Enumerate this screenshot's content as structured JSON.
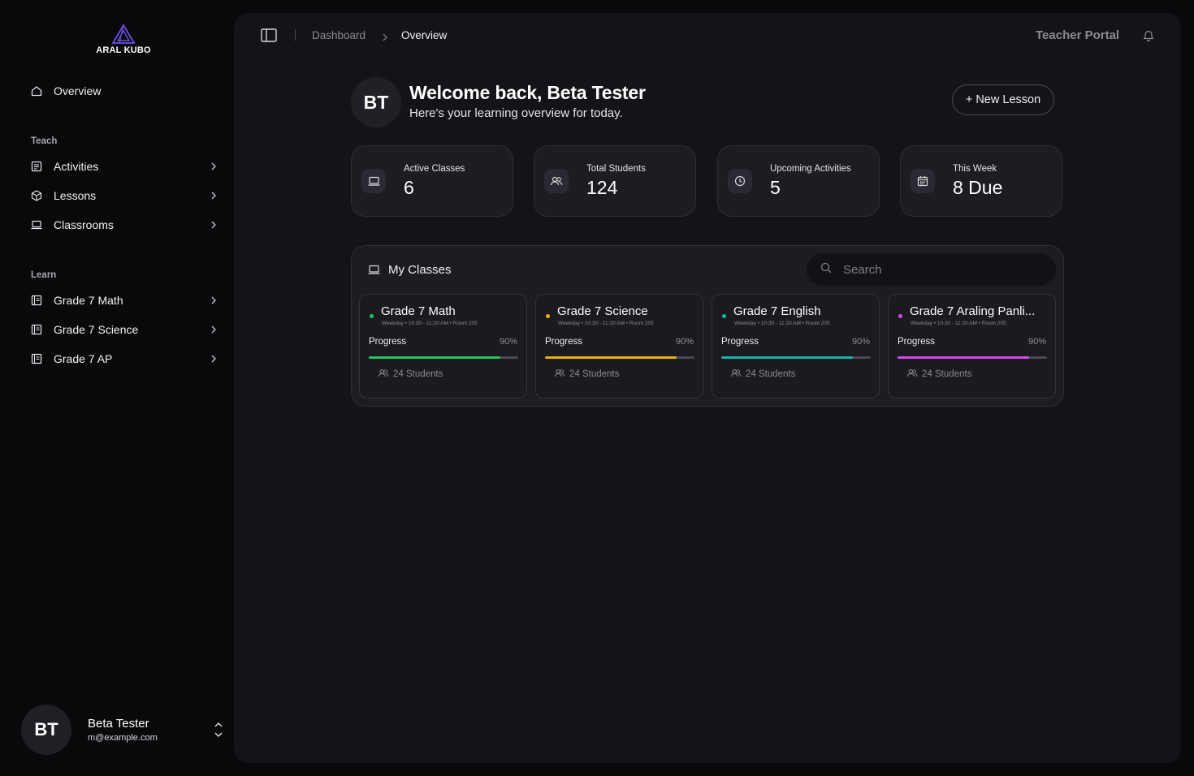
{
  "brand": {
    "name": "ARAL KUBO",
    "accent": "#6d4fe0"
  },
  "sidebar": {
    "overview_label": "Overview",
    "teach_title": "Teach",
    "teach_items": [
      {
        "label": "Activities",
        "icon": "activity-icon"
      },
      {
        "label": "Lessons",
        "icon": "cube-icon"
      },
      {
        "label": "Classrooms",
        "icon": "laptop-icon"
      }
    ],
    "learn_title": "Learn",
    "learn_items": [
      {
        "label": "Grade 7 Math",
        "icon": "book-icon"
      },
      {
        "label": "Grade 7 Science",
        "icon": "book-icon"
      },
      {
        "label": "Grade 7 AP",
        "icon": "book-icon"
      }
    ],
    "user": {
      "initials": "BT",
      "name": "Beta Tester",
      "email": "m@example.com"
    }
  },
  "topbar": {
    "breadcrumb": [
      "Dashboard",
      "Overview"
    ],
    "portal_label": "Teacher Portal"
  },
  "welcome": {
    "initials": "BT",
    "title": "Welcome back, Beta Tester",
    "subtitle": "Here's your learning overview for today.",
    "new_lesson_label": "+ New Lesson"
  },
  "stats": [
    {
      "label": "Active Classes",
      "value": "6",
      "icon": "laptop-icon"
    },
    {
      "label": "Total Students",
      "value": "124",
      "icon": "users-icon"
    },
    {
      "label": "Upcoming Activities",
      "value": "5",
      "icon": "clock-icon"
    },
    {
      "label": "This Week",
      "value": "8 Due",
      "icon": "calendar-icon"
    }
  ],
  "my_classes": {
    "title": "My Classes",
    "search_placeholder": "Search",
    "classes": [
      {
        "name": "Grade 7 Math",
        "schedule": "Weekday • 10:30 - 11:20 AM • Room 205",
        "progress_label": "Progress",
        "progress_text": "90%",
        "progress": 0.88,
        "students": "24 Students",
        "color": "#22c55e"
      },
      {
        "name": "Grade 7 Science",
        "schedule": "Weekday • 10:30 - 11:20 AM • Room 205",
        "progress_label": "Progress",
        "progress_text": "90%",
        "progress": 0.88,
        "students": "24 Students",
        "color": "#eab308"
      },
      {
        "name": "Grade 7 English",
        "schedule": "Weekday • 10:30 - 11:20 AM • Room 205",
        "progress_label": "Progress",
        "progress_text": "90%",
        "progress": 0.88,
        "students": "24 Students",
        "color": "#14b8a6"
      },
      {
        "name": "Grade 7 Araling Panli...",
        "schedule": "Weekday • 10:30 - 11:20 AM • Room 205",
        "progress_label": "Progress",
        "progress_text": "90%",
        "progress": 0.88,
        "students": "24 Students",
        "color": "#d946ef"
      }
    ]
  }
}
